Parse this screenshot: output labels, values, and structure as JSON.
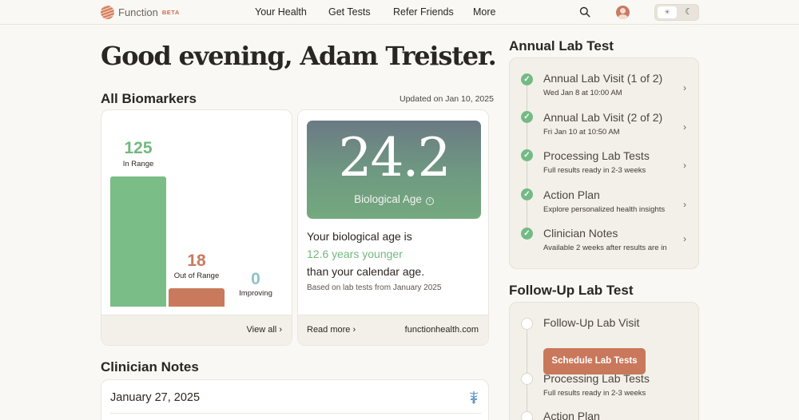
{
  "brand": {
    "name": "Function",
    "badge": "BETA"
  },
  "nav": {
    "links": [
      "Your Health",
      "Get Tests",
      "Refer Friends",
      "More"
    ],
    "search_icon": "search-icon",
    "avatar_icon": "avatar",
    "theme_toggle": {
      "light_icon": "sun-icon",
      "dark_icon": "moon-icon"
    }
  },
  "greeting": "Good evening, Adam Treister.",
  "biomarkers": {
    "title": "All Biomarkers",
    "updated": "Updated on Jan 10, 2025",
    "in_range": {
      "value": "125",
      "label": "In Range",
      "color": "#7abd86"
    },
    "out_of_range": {
      "value": "18",
      "label": "Out of Range",
      "color": "#c97a5c"
    },
    "improving": {
      "value": "0",
      "label": "Improving",
      "color": "#8fc2c9"
    },
    "view_all": "View all"
  },
  "bio_age": {
    "value": "24.2",
    "label": "Biological Age",
    "line1": "Your biological age is",
    "line2": "12.6 years younger",
    "line3": "than your calendar age.",
    "note": "Based on lab tests from January 2025",
    "read_more": "Read more",
    "source": "functionhealth.com"
  },
  "clinician_notes": {
    "title": "Clinician Notes",
    "date": "January 27, 2025"
  },
  "annual": {
    "title": "Annual Lab Test",
    "steps": [
      {
        "title": "Annual Lab Visit (1 of 2)",
        "sub": "Wed Jan 8 at 10:00 AM"
      },
      {
        "title": "Annual Lab Visit (2 of 2)",
        "sub": "Fri Jan 10 at 10:50 AM"
      },
      {
        "title": "Processing Lab Tests",
        "sub": "Full results ready in 2-3 weeks"
      },
      {
        "title": "Action Plan",
        "sub": "Explore personalized health insights"
      },
      {
        "title": "Clinician Notes",
        "sub": "Available 2 weeks after results are in"
      }
    ]
  },
  "followup": {
    "title": "Follow-Up Lab Test",
    "steps": [
      {
        "title": "Follow-Up Lab Visit"
      },
      {
        "title": "Processing Lab Tests",
        "sub": "Full results ready in 2-3 weeks"
      },
      {
        "title": "Action Plan"
      }
    ],
    "schedule_label": "Schedule Lab Tests"
  },
  "colors": {
    "accent": "#c9785b",
    "success": "#74ba86",
    "background": "#faf8f4"
  }
}
